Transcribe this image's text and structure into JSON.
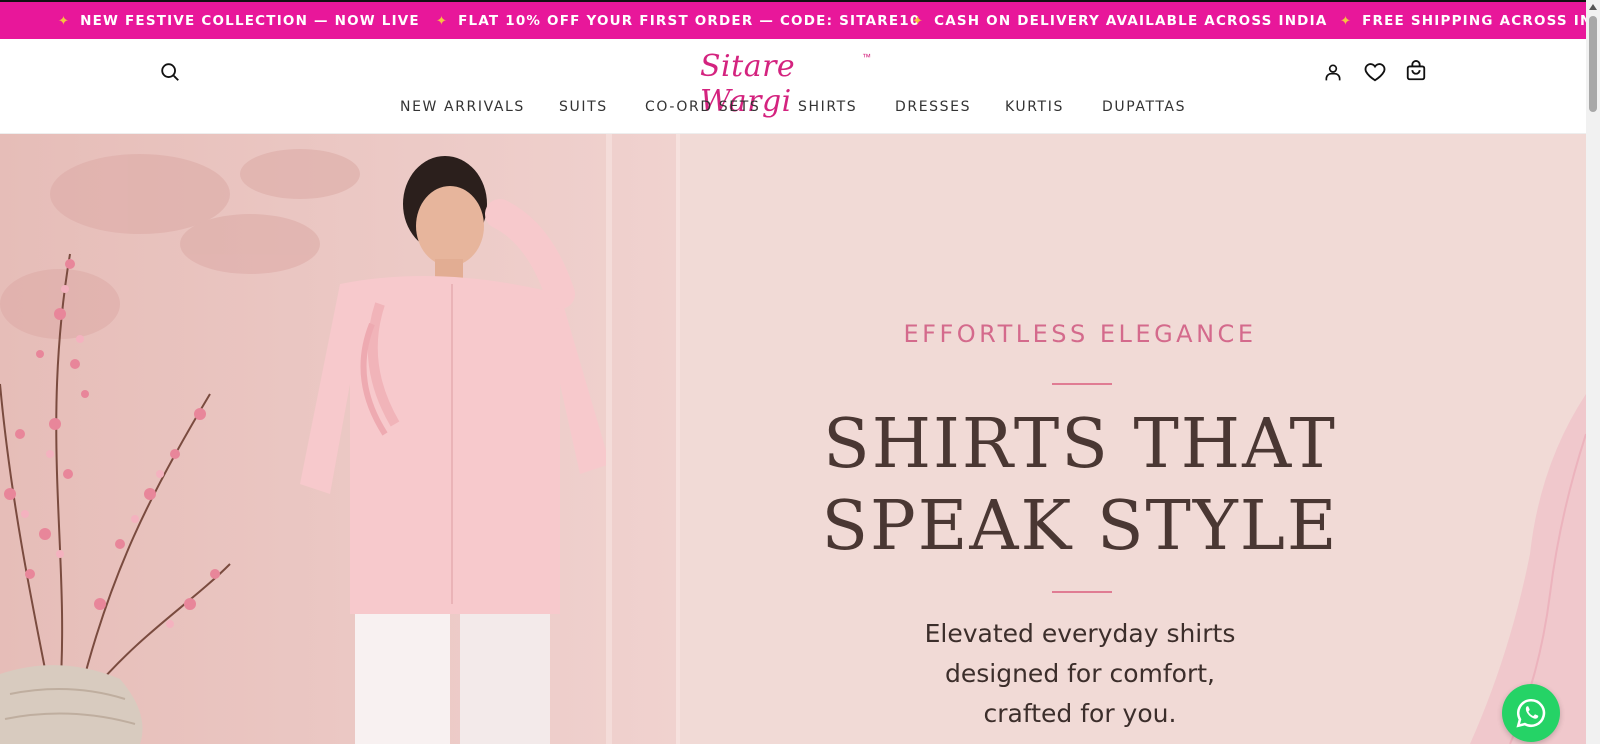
{
  "announcement": {
    "items": [
      "NEW FESTIVE COLLECTION — NOW LIVE",
      "FLAT 10% OFF YOUR FIRST ORDER — CODE: SITARE10",
      "CASH ON DELIVERY AVAILABLE ACROSS INDIA",
      "FREE SHIPPING ACROSS INDIA"
    ],
    "star": "✦"
  },
  "header": {
    "logo_text": "Sitare Wargi",
    "logo_tm": "™",
    "icons": [
      "search-icon",
      "account-icon",
      "wishlist-icon",
      "cart-icon"
    ],
    "nav": [
      "NEW ARRIVALS",
      "SUITS",
      "CO-ORD SETS",
      "SHIRTS",
      "DRESSES",
      "KURTIS",
      "DUPATTAS"
    ]
  },
  "hero": {
    "eyebrow": "EFFORTLESS ELEGANCE",
    "headline_line1": "SHIRTS THAT",
    "headline_line2": "SPEAK STYLE",
    "sub_line1": "Elevated everyday shirts",
    "sub_line2": "designed for comfort,",
    "sub_line3": "crafted for you."
  },
  "colors": {
    "brand": "#e8179a",
    "accent_star": "#f5c242",
    "headline": "#4a3733",
    "eyebrow": "#d46a8c",
    "whatsapp": "#25d366"
  }
}
